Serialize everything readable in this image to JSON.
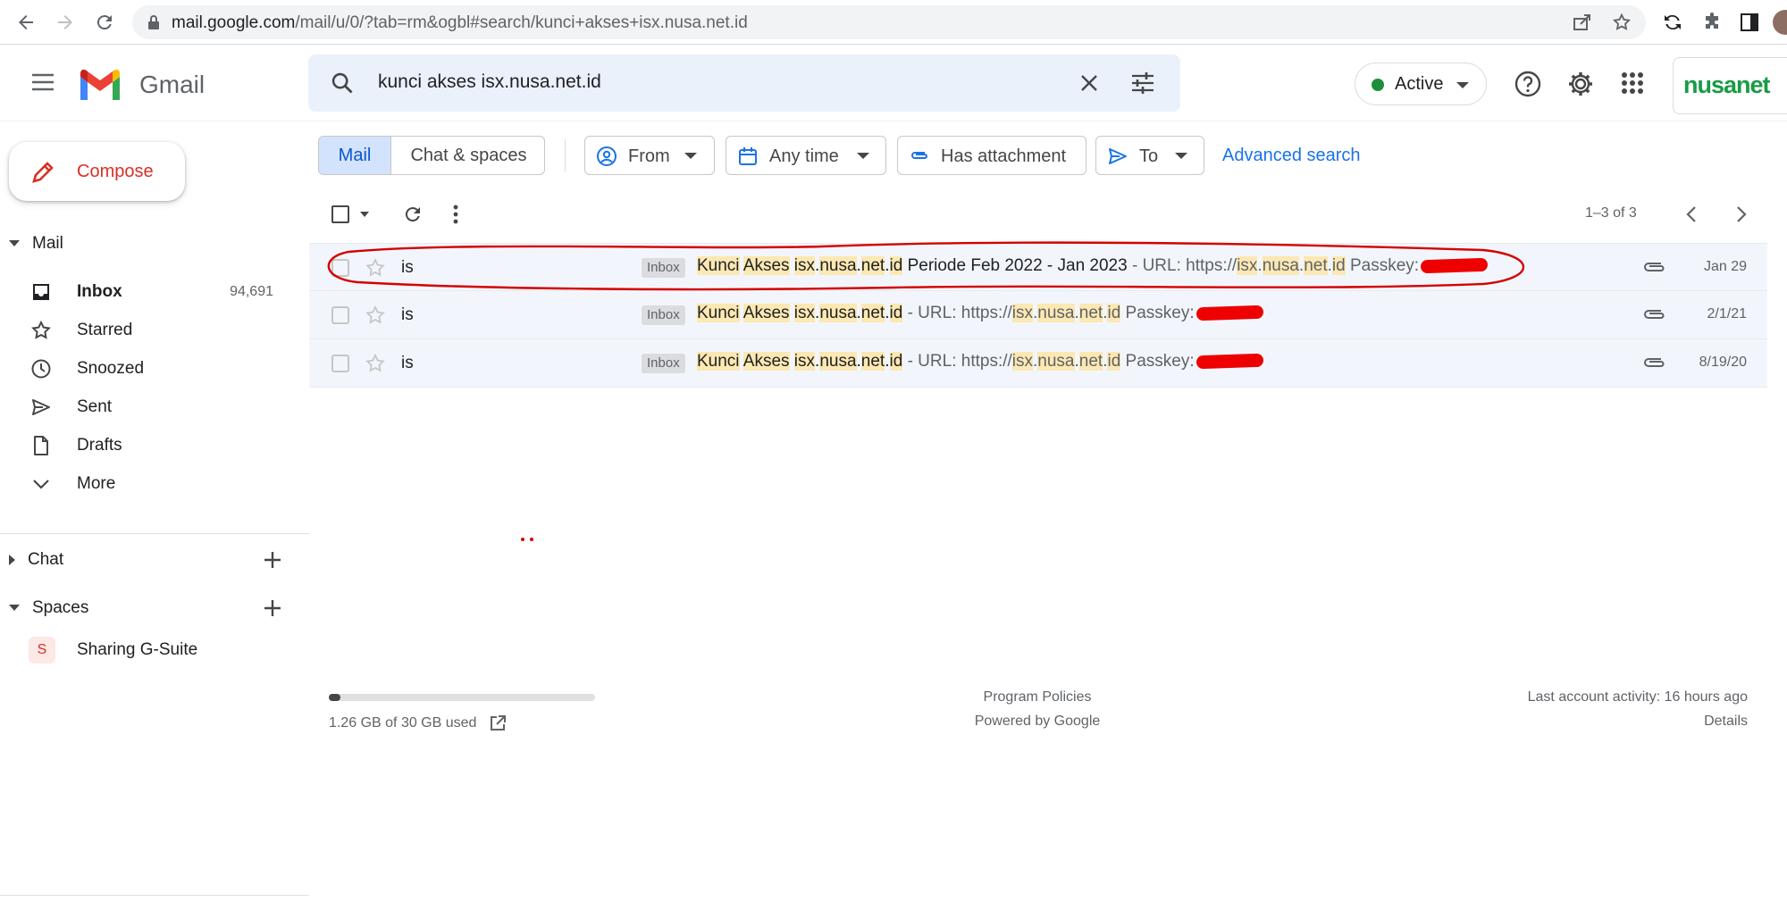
{
  "browser": {
    "url_host": "mail.google.com",
    "url_path": "/mail/u/0/?tab=rm&ogbl#search/kunci+akses+isx.nusa.net.id"
  },
  "header": {
    "app_name": "Gmail",
    "search_query": "kunci akses isx.nusa.net.id",
    "status_label": "Active",
    "org_logo_text": "nusanet"
  },
  "sidebar": {
    "compose_label": "Compose",
    "mail_section": "Mail",
    "items": [
      {
        "label": "Inbox",
        "count": "94,691",
        "icon": "inbox-icon"
      },
      {
        "label": "Starred",
        "count": "",
        "icon": "star-icon"
      },
      {
        "label": "Snoozed",
        "count": "",
        "icon": "clock-icon"
      },
      {
        "label": "Sent",
        "count": "",
        "icon": "send-icon"
      },
      {
        "label": "Drafts",
        "count": "",
        "icon": "draft-icon"
      },
      {
        "label": "More",
        "count": "",
        "icon": "chevron-down-icon"
      }
    ],
    "chat_section": "Chat",
    "spaces_section": "Spaces",
    "space_item": {
      "avatar": "S",
      "label": "Sharing G-Suite"
    }
  },
  "filters": {
    "tab_mail": "Mail",
    "tab_chat": "Chat & spaces",
    "from": "From",
    "any_time": "Any time",
    "has_attachment": "Has attachment",
    "to": "To",
    "advanced_search": "Advanced search"
  },
  "toolbar": {
    "page_count": "1–3 of 3"
  },
  "emails": [
    {
      "sender": "is",
      "label": "Inbox",
      "subject_rest": " Periode Feb 2022 - Jan 2023",
      "snippet": " - URL: https://",
      "passkey": " Passkey:",
      "date": "Jan 29"
    },
    {
      "sender": "is",
      "label": "Inbox",
      "subject_rest": "",
      "snippet": " - URL: https://",
      "passkey": " Passkey:",
      "date": "2/1/21"
    },
    {
      "sender": "is",
      "label": "Inbox",
      "subject_rest": "",
      "snippet": " - URL: https://",
      "passkey": " Passkey:",
      "date": "8/19/20"
    }
  ],
  "highlight": {
    "kunci": "Kunci",
    "akses": "Akses",
    "isx": "isx",
    "nusa": "nusa",
    "net": "net",
    "id": "id",
    "dot": "."
  },
  "footer": {
    "storage_text": "1.26 GB of 30 GB used",
    "storage_fraction": 0.042,
    "program_policies": "Program Policies",
    "powered_by": "Powered by Google",
    "last_activity": "Last account activity: 16 hours ago",
    "details": "Details"
  },
  "colors": {
    "accent": "#0b57d0",
    "highlight": "#fce8b2",
    "annotation": "#e00000",
    "active_green": "#1e8e3e",
    "brand_green": "#1a9b45"
  }
}
